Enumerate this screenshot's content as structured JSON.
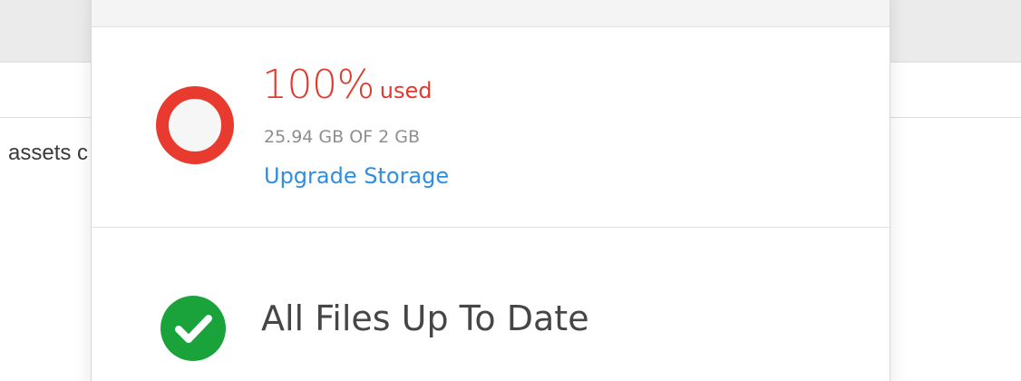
{
  "background_app": {
    "partial_text": "assets c"
  },
  "storage": {
    "percent_value": "100%",
    "percent_suffix": "used",
    "usage_detail": "25.94 GB OF 2 GB",
    "upgrade_label": "Upgrade Storage",
    "usage_fraction": 1.0
  },
  "sync": {
    "status_text": "All Files Up To Date"
  },
  "colors": {
    "alert_red": "#e83a2e",
    "link_blue": "#2d8ee3",
    "success_green": "#1aa33a",
    "muted_text": "#8e8e8e"
  },
  "icons": {
    "storage": "storage-ring-icon",
    "sync": "checkmark-circle-icon"
  }
}
